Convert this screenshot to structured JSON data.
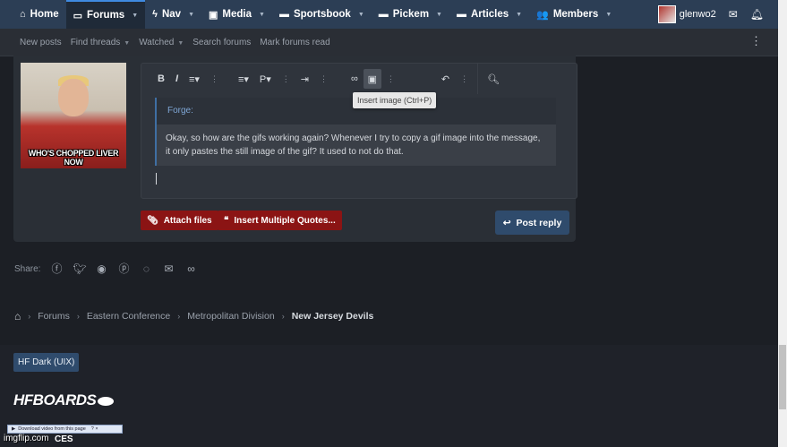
{
  "topnav": {
    "items": [
      {
        "label": "Home",
        "icon": "home-icon",
        "has_caret": false
      },
      {
        "label": "Forums",
        "icon": "forums-icon",
        "has_caret": true,
        "active": true
      },
      {
        "label": "Nav",
        "icon": "bolt-icon",
        "has_caret": true
      },
      {
        "label": "Media",
        "icon": "image-icon",
        "has_caret": true
      },
      {
        "label": "Sportsbook",
        "icon": "folder-icon",
        "has_caret": true
      },
      {
        "label": "Pickem",
        "icon": "folder-icon",
        "has_caret": true
      },
      {
        "label": "Articles",
        "icon": "folder-icon",
        "has_caret": true
      },
      {
        "label": "Members",
        "icon": "members-icon",
        "has_caret": true
      }
    ],
    "username": "glenwo2"
  },
  "subnav": {
    "items": [
      {
        "label": "New posts",
        "has_caret": false
      },
      {
        "label": "Find threads",
        "has_caret": true
      },
      {
        "label": "Watched",
        "has_caret": true
      },
      {
        "label": "Search forums",
        "has_caret": false
      },
      {
        "label": "Mark forums read",
        "has_caret": false
      }
    ]
  },
  "avatar": {
    "caption": "WHO'S CHOPPED LIVER NOW"
  },
  "editor": {
    "tooltip": "Insert image (Ctrl+P)",
    "quote_author": "Forge:",
    "quote_text": "Okay, so how are the gifs working again? Whenever I try to copy a gif image into the message, it only pastes the still image of the gif? It used to not do that."
  },
  "buttons": {
    "attach_files": "Attach files",
    "insert_quotes": "Insert Multiple Quotes...",
    "post_reply": "Post reply"
  },
  "share": {
    "label": "Share:"
  },
  "breadcrumb": {
    "items": [
      "Forums",
      "Eastern Conference",
      "Metropolitan Division"
    ],
    "current": "New Jersey Devils"
  },
  "footer": {
    "style_chooser": "HF Dark (UIX)",
    "logo": "HFBOARDS",
    "imgflip_bar": "Download video from this page",
    "imgflip": "imgflip.com",
    "ces_fragment": "CES"
  },
  "colors": {
    "nav_bg": "#2c3e55",
    "accent_red": "#8b1414",
    "accent_blue": "#2f4b6c"
  }
}
